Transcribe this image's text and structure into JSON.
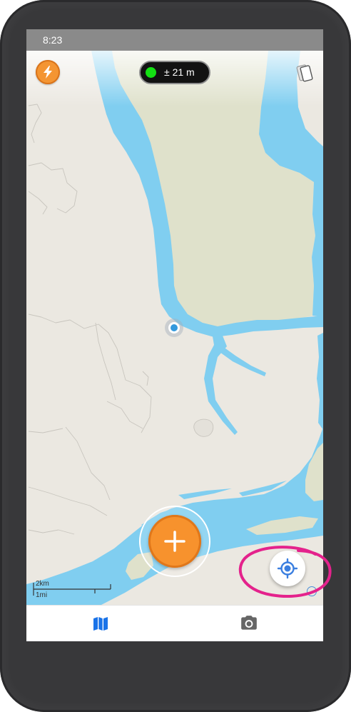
{
  "status_bar": {
    "time": "8:23"
  },
  "map": {
    "colors": {
      "land": "#ebe8e1",
      "water": "#80cef0",
      "vegetation": "#dfe1cb",
      "boundary": "#c8c5be"
    },
    "top_controls": {
      "quick_action_icon": "lightning-bolt-icon",
      "gps_status_color": "#13e013",
      "accuracy_label": "± 21 m",
      "layers_icon": "layers-icon"
    },
    "current_location_icon": "location-dot-icon",
    "scale_bar": {
      "metric_label": "2km",
      "imperial_label": "1mi"
    },
    "add_button": {
      "icon": "plus-icon",
      "color": "#f7922d"
    },
    "locate_button": {
      "icon": "crosshair-icon",
      "color": "#3b7fe0"
    },
    "info_icon": "info-icon",
    "annotation": {
      "color": "#e4228c"
    }
  },
  "bottom_nav": {
    "active_color": "#1a73e8",
    "inactive_color": "#666666",
    "items": [
      {
        "icon": "map-icon",
        "active": true
      },
      {
        "icon": "camera-icon",
        "active": false
      }
    ]
  }
}
